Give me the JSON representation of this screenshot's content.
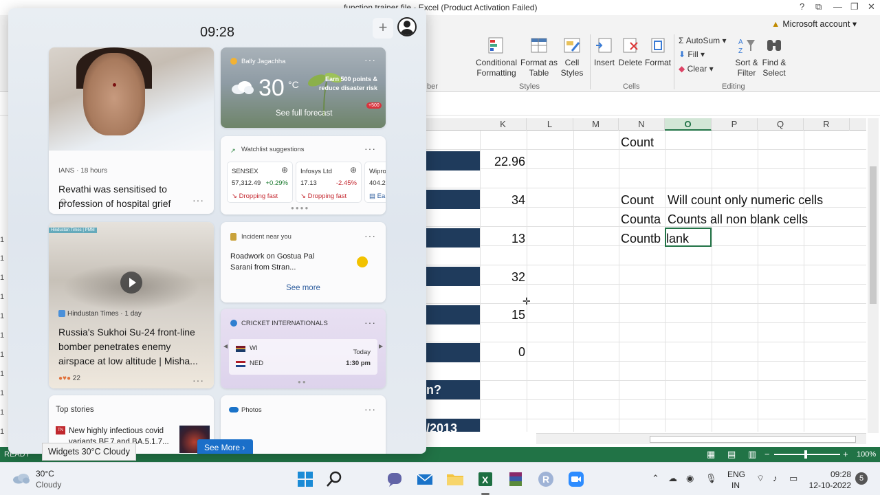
{
  "excel": {
    "window_title": "function trainer file - Excel (Product Activation Failed)",
    "account": "Microsoft account",
    "ribbon": {
      "conditional_formatting": "Conditional Formatting",
      "format_as_table": "Format as Table",
      "cell_styles": "Cell Styles",
      "insert": "Insert",
      "delete": "Delete",
      "format": "Format",
      "autosum": "AutoSum",
      "fill": "Fill",
      "clear": "Clear",
      "sort_filter": "Sort & Filter",
      "find_select": "Find & Select",
      "group_styles": "Styles",
      "group_cells": "Cells",
      "group_editing": "Editing",
      "group_number": "ber"
    },
    "columns": [
      "K",
      "L",
      "M",
      "N",
      "O",
      "P",
      "Q",
      "R"
    ],
    "selected_column": "O",
    "values": [
      "22.96",
      "34",
      "13",
      "32",
      "15",
      "0"
    ],
    "cells": {
      "n1": "Count",
      "n4": "Count",
      "o4": "Will count only numeric cells",
      "n5": "Counta",
      "o5": "Counts all non blank cells",
      "n6": "Countb",
      "o6": "lank"
    },
    "partial_text": [
      "n?",
      "/2013"
    ],
    "row_stubs": [
      "1",
      "1",
      "1",
      "1",
      "1",
      "1",
      "1",
      "1",
      "1",
      "1",
      "1"
    ],
    "status": "READY",
    "zoom": "100%"
  },
  "widgets": {
    "time": "09:28",
    "news1": {
      "source": "IANS · 18 hours",
      "headline": "Revathi was sensitised to profession of hospital grief counsellor, says 'Aye Zindagi'..."
    },
    "weather": {
      "location": "Bally Jagachha",
      "temp": "30",
      "unit": "°C",
      "promo": "Earn 500 points & reduce disaster risk",
      "forecast": "See full forecast",
      "badge": "+500"
    },
    "watchlist": {
      "title": "Watchlist suggestions",
      "stocks": [
        {
          "name": "SENSEX",
          "price": "57,312.49",
          "change": "+0.29%",
          "trend": "Dropping fast"
        },
        {
          "name": "Infosys Ltd",
          "price": "17.13",
          "change": "-2.45%",
          "trend": "Dropping fast"
        },
        {
          "name": "Wipro",
          "price": "404.2",
          "change": "",
          "trend": "Ea"
        }
      ]
    },
    "news2": {
      "tag": "Hindustan Times | PMM",
      "source": "Hindustan Times · 1 day",
      "headline": "Russia's Sukhoi Su-24 front-line bomber penetrates enemy airspace at low altitude | Misha...",
      "reactions": "22"
    },
    "incident": {
      "title": "Incident near you",
      "body": "Roadwork on Gostua Pal Sarani from Stran...",
      "see_more": "See more"
    },
    "cricket": {
      "title": "CRICKET INTERNATIONALS",
      "team1": "WI",
      "team2": "NED",
      "day": "Today",
      "time": "1:30 pm"
    },
    "top_stories": {
      "title": "Top stories",
      "story": "New highly infectious covid variants BF.7 and BA.5.1.7...",
      "tn": "TN"
    },
    "photos": {
      "title": "Photos"
    },
    "see_more_button": "See More",
    "tooltip": "Widgets 30°C Cloudy"
  },
  "taskbar": {
    "weather_temp": "30°C",
    "weather_desc": "Cloudy",
    "lang1": "ENG",
    "lang2": "IN",
    "time": "09:28",
    "date": "12-10-2022",
    "notifications": "5"
  }
}
